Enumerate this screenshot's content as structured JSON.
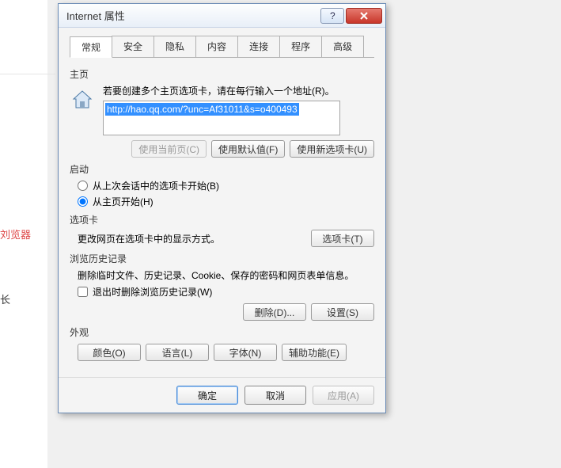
{
  "background": {
    "text1": "刘览器",
    "text2": "长"
  },
  "dialog_title": "Internet 属性",
  "tabs": [
    "常规",
    "安全",
    "隐私",
    "内容",
    "连接",
    "程序",
    "高级"
  ],
  "active_tab": 0,
  "home": {
    "heading": "主页",
    "desc": "若要创建多个主页选项卡，请在每行输入一个地址(R)。",
    "url": "http://hao.qq.com/?unc=Af31011&s=o400493",
    "btn_current": "使用当前页(C)",
    "btn_default": "使用默认值(F)",
    "btn_newtab": "使用新选项卡(U)"
  },
  "startup": {
    "heading": "启动",
    "option_session": "从上次会话中的选项卡开始(B)",
    "option_home": "从主页开始(H)",
    "selected": "home"
  },
  "tabcard": {
    "heading": "选项卡",
    "desc": "更改网页在选项卡中的显示方式。",
    "btn": "选项卡(T)"
  },
  "history": {
    "heading": "浏览历史记录",
    "desc": "删除临时文件、历史记录、Cookie、保存的密码和网页表单信息。",
    "cb_exit": "退出时删除浏览历史记录(W)",
    "btn_delete": "删除(D)...",
    "btn_settings": "设置(S)"
  },
  "appearance": {
    "heading": "外观",
    "btn_color": "颜色(O)",
    "btn_lang": "语言(L)",
    "btn_font": "字体(N)",
    "btn_access": "辅助功能(E)"
  },
  "footer": {
    "ok": "确定",
    "cancel": "取消",
    "apply": "应用(A)"
  }
}
